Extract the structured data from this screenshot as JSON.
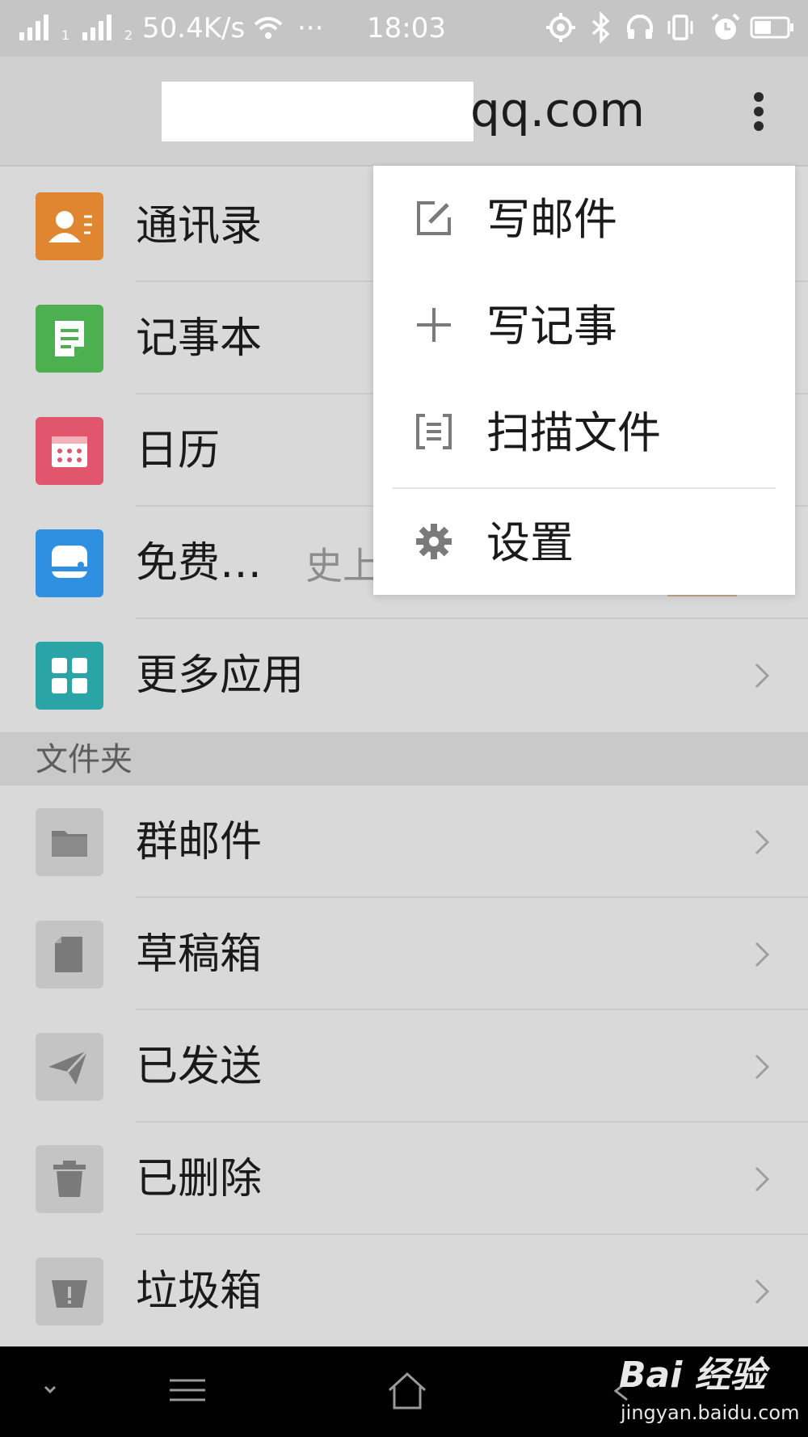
{
  "status_bar": {
    "sim1": "1",
    "sim2": "2",
    "speed": "50.4K/s",
    "dots": "···",
    "time": "18:03"
  },
  "header": {
    "title": "qq.com"
  },
  "apps": [
    {
      "label": "通讯录",
      "icon": "contacts-icon",
      "color": "#e08631"
    },
    {
      "label": "记事本",
      "icon": "notepad-icon",
      "color": "#4caf50"
    },
    {
      "label": "日历",
      "icon": "calendar-icon",
      "color": "#e2566d"
    },
    {
      "label": "免费…",
      "sub": "史上",
      "icon": "chat-bubble-icon",
      "color": "#2f8fe0"
    },
    {
      "label": "更多应用",
      "icon": "grid-icon",
      "color": "#2aa4a7"
    }
  ],
  "section": {
    "title": "文件夹"
  },
  "folders": [
    {
      "label": "群邮件",
      "icon": "folder-icon"
    },
    {
      "label": "草稿箱",
      "icon": "draft-icon"
    },
    {
      "label": "已发送",
      "icon": "paper-plane-icon"
    },
    {
      "label": "已删除",
      "icon": "trash-icon"
    },
    {
      "label": "垃圾箱",
      "icon": "spam-bin-icon"
    }
  ],
  "menu": {
    "items": [
      {
        "label": "写邮件",
        "icon": "compose-icon"
      },
      {
        "label": "写记事",
        "icon": "plus-icon"
      },
      {
        "label": "扫描文件",
        "icon": "scan-icon"
      },
      {
        "label": "设置",
        "icon": "gear-icon"
      }
    ]
  },
  "watermark": {
    "logo": "Bai 经验",
    "url": "jingyan.baidu.com"
  }
}
